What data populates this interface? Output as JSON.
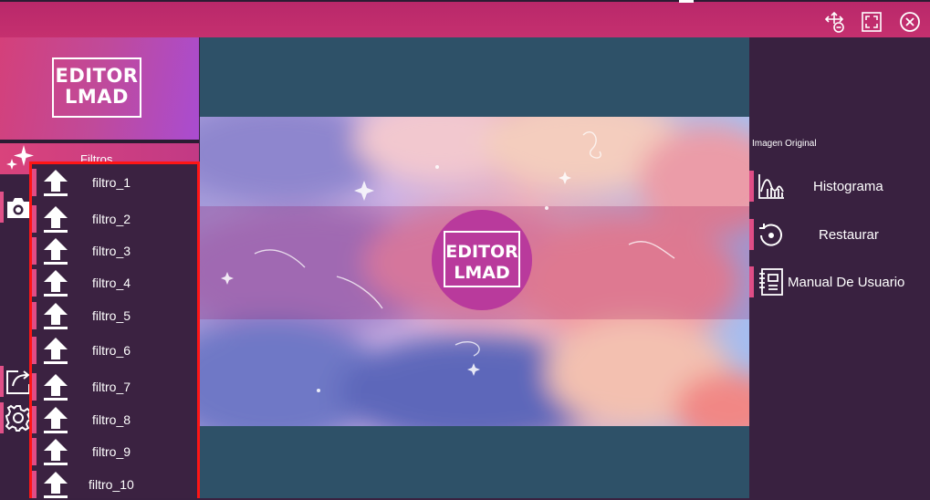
{
  "app": {
    "logo_line1": "EDITOR",
    "logo_line2": "LMAD",
    "canvas_logo_line1": "EDITOR",
    "canvas_logo_line2": "LMAD"
  },
  "window_controls": {
    "move_icon": "move-arrows-icon",
    "fullscreen_icon": "fullscreen-icon",
    "close_icon": "close-circle-icon"
  },
  "sidebar": {
    "filtros_label": "Filtros",
    "filters": [
      {
        "label": "filtro_1"
      },
      {
        "label": "filtro_2"
      },
      {
        "label": "filtro_3"
      },
      {
        "label": "filtro_4"
      },
      {
        "label": "filtro_5"
      },
      {
        "label": "filtro_6"
      },
      {
        "label": "filtro_7"
      },
      {
        "label": "filtro_8"
      },
      {
        "label": "filtro_9"
      },
      {
        "label": "filtro_10"
      }
    ]
  },
  "right_panel": {
    "image_original_label": "Imagen Original",
    "histogram_label": "Histograma",
    "restore_label": "Restaurar",
    "manual_label": "Manual De Usuario"
  },
  "colors": {
    "accent": "#c5306f",
    "panel": "#392140",
    "canvas_bg": "#2e5168",
    "highlight_border": "#ff1515"
  }
}
